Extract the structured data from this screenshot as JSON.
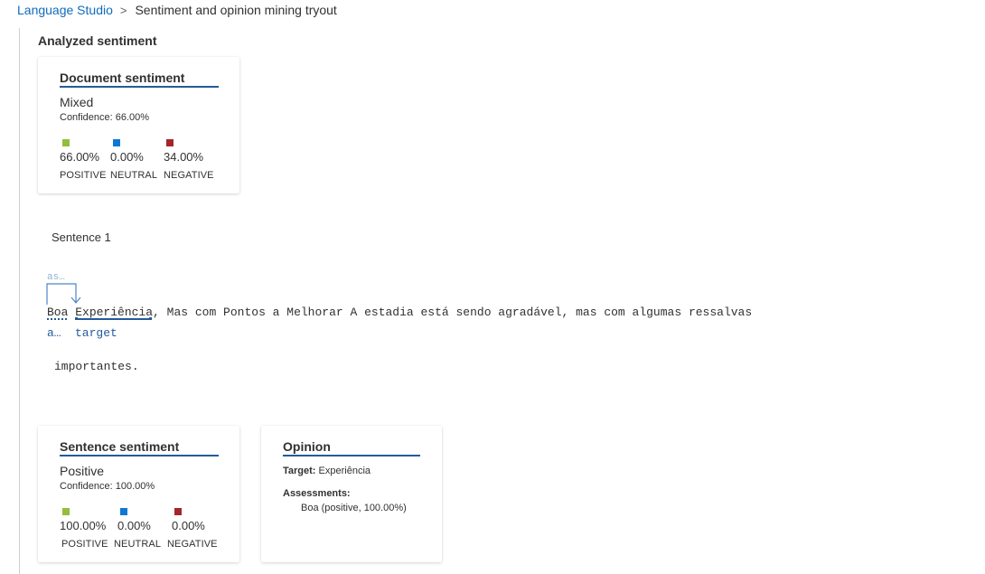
{
  "breadcrumb": {
    "root": "Language Studio",
    "separator": ">",
    "current": "Sentiment and opinion mining tryout"
  },
  "section_title": "Analyzed sentiment",
  "document_sentiment": {
    "title": "Document sentiment",
    "label": "Mixed",
    "confidence": "Confidence: 66.00%",
    "scores": [
      {
        "value": "66.00%",
        "caption": "POSITIVE",
        "color": "#94bd3c"
      },
      {
        "value": "0.00%",
        "caption": "NEUTRAL",
        "color": "#0f78d4"
      },
      {
        "value": "34.00%",
        "caption": "NEGATIVE",
        "color": "#a4262c"
      }
    ]
  },
  "sentence": {
    "label": "Sentence 1",
    "line1_word1": "Boa",
    "line1_word2": "Experiência",
    "line1_rest": ", Mas com Pontos a Melhorar A estadia está sendo agradável, mas com algumas ressalvas",
    "line2": "importantes.",
    "tag_above": "as…",
    "tag_assessment": "a…",
    "tag_target": "target"
  },
  "sentence_sentiment": {
    "title": "Sentence sentiment",
    "label": "Positive",
    "confidence": "Confidence: 100.00%",
    "scores": [
      {
        "value": "100.00%",
        "caption": "POSITIVE",
        "color": "#94bd3c"
      },
      {
        "value": "0.00%",
        "caption": "NEUTRAL",
        "color": "#0f78d4"
      },
      {
        "value": "0.00%",
        "caption": "NEGATIVE",
        "color": "#a4262c"
      }
    ]
  },
  "opinion": {
    "title": "Opinion",
    "target_label": "Target:",
    "target_value": "Experiência",
    "assessments_label": "Assessments:",
    "assessment_1": "Boa (positive, 100.00%)"
  },
  "colors": {
    "accent": "#245b9b",
    "link": "#0f6cbd",
    "positive": "#94bd3c",
    "neutral": "#0f78d4",
    "negative": "#a4262c"
  }
}
